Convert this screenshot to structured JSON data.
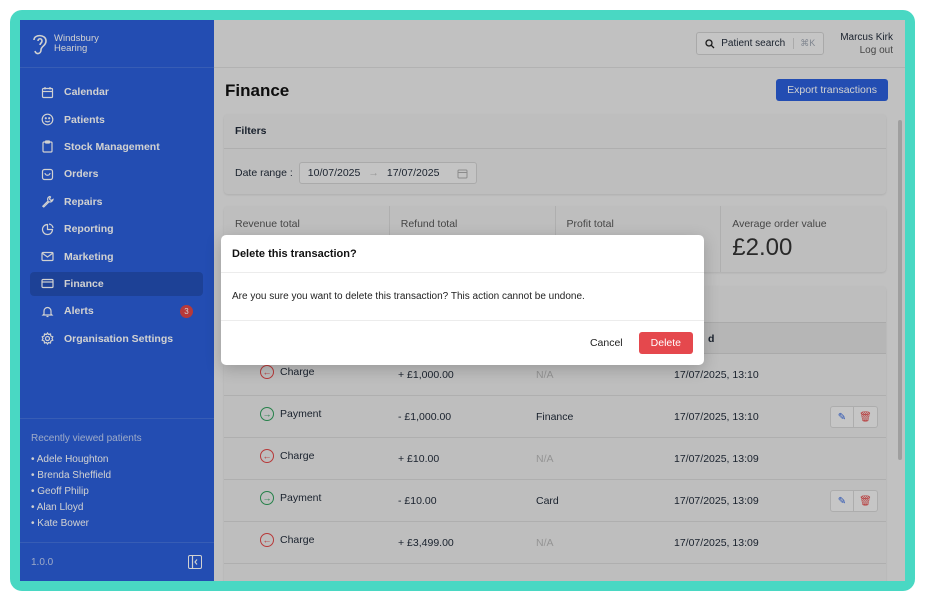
{
  "brand": {
    "line1": "Windsbury",
    "line2": "Hearing",
    "logo_icon": "ear-icon"
  },
  "nav": [
    {
      "label": "Calendar",
      "icon": "calendar-icon"
    },
    {
      "label": "Patients",
      "icon": "smile-icon"
    },
    {
      "label": "Stock Management",
      "icon": "clipboard-icon"
    },
    {
      "label": "Orders",
      "icon": "box-icon"
    },
    {
      "label": "Repairs",
      "icon": "wrench-icon"
    },
    {
      "label": "Reporting",
      "icon": "pie-chart-icon"
    },
    {
      "label": "Marketing",
      "icon": "mail-icon"
    },
    {
      "label": "Finance",
      "icon": "credit-card-icon",
      "active": true
    },
    {
      "label": "Alerts",
      "icon": "bell-icon",
      "badge": "3"
    },
    {
      "label": "Organisation Settings",
      "icon": "gear-icon"
    }
  ],
  "recent": {
    "title": "Recently viewed patients",
    "patients": [
      "• Adele Houghton",
      "• Brenda Sheffield",
      "• Geoff Philip",
      "• Alan Lloyd",
      "• Kate Bower"
    ]
  },
  "version": "1.0.0",
  "topbar": {
    "search_label": "Patient search",
    "search_shortcut": "⌘K",
    "user_name": "Marcus Kirk",
    "logout": "Log out"
  },
  "page": {
    "title": "Finance",
    "export_label": "Export transactions"
  },
  "filters": {
    "title": "Filters",
    "date_label": "Date range :",
    "start": "10/07/2025",
    "end": "17/07/2025"
  },
  "stats": [
    {
      "label": "Revenue total",
      "value": ""
    },
    {
      "label": "Refund total",
      "value": ""
    },
    {
      "label": "Profit total",
      "value": ""
    },
    {
      "label": "Average order value",
      "value": "£2.00"
    }
  ],
  "table": {
    "date_header_fragment": "d",
    "rows": [
      {
        "type": "Charge",
        "amount": "+ £1,000.00",
        "method": "N/A",
        "date": "17/07/2025, 13:10",
        "actions": false
      },
      {
        "type": "Payment",
        "amount": "- £1,000.00",
        "method": "Finance",
        "date": "17/07/2025, 13:10",
        "actions": true
      },
      {
        "type": "Charge",
        "amount": "+ £10.00",
        "method": "N/A",
        "date": "17/07/2025, 13:09",
        "actions": false
      },
      {
        "type": "Payment",
        "amount": "- £10.00",
        "method": "Card",
        "date": "17/07/2025, 13:09",
        "actions": true
      },
      {
        "type": "Charge",
        "amount": "+ £3,499.00",
        "method": "N/A",
        "date": "17/07/2025, 13:09",
        "actions": false
      }
    ]
  },
  "modal": {
    "title": "Delete this transaction?",
    "body": "Are you sure you want to delete this transaction? This action cannot be undone.",
    "cancel": "Cancel",
    "confirm": "Delete"
  },
  "colors": {
    "frame": "#49d8c3",
    "sidebar": "#2b5fd9",
    "danger": "#e5484d",
    "success": "#2f9e5b"
  }
}
